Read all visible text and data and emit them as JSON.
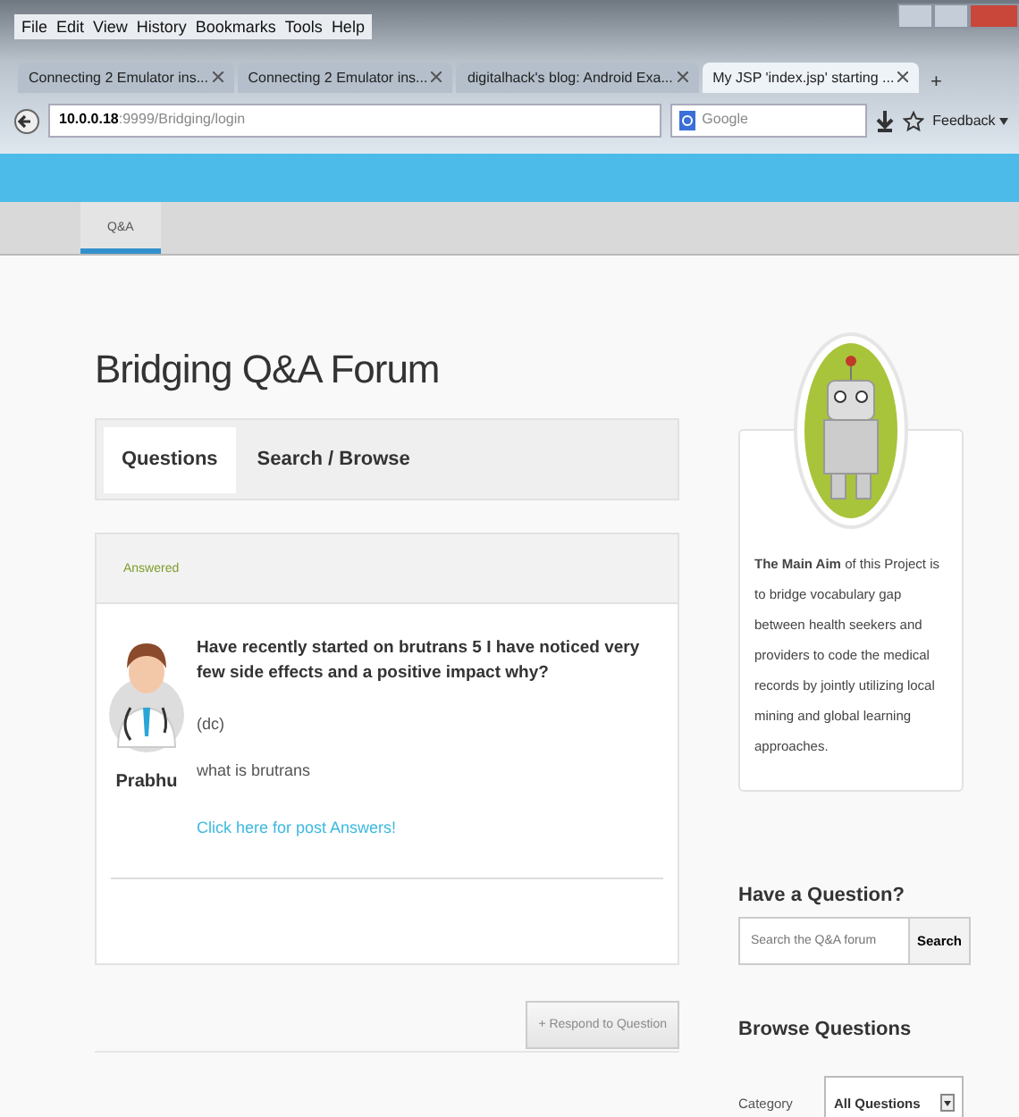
{
  "browser": {
    "menu": [
      "File",
      "Edit",
      "View",
      "History",
      "Bookmarks",
      "Tools",
      "Help"
    ],
    "tabs": [
      {
        "title": "Connecting 2 Emulator ins...",
        "selected": false
      },
      {
        "title": "Connecting 2 Emulator ins...",
        "selected": false
      },
      {
        "title": "digitalhack's blog: Android Exa...",
        "selected": false
      },
      {
        "title": "My JSP 'index.jsp' starting ...",
        "selected": true
      }
    ],
    "new_tab": "+",
    "address_host": "10.0.0.18",
    "address_rest": ":9999/Bridging/login",
    "search_placeholder": "Google",
    "feedback": "Feedback"
  },
  "site_nav": [
    {
      "label": "Q&A",
      "selected": true
    }
  ],
  "page_title": "Bridging Q&A Forum",
  "tabs": [
    {
      "label": "Questions",
      "selected": true
    },
    {
      "label": "Search / Browse",
      "selected": false
    }
  ],
  "question": {
    "status": "Answered",
    "author": "Prabhu",
    "title": "Have recently started on brutrans 5 I have noticed very few side effects and a positive impact why?",
    "tag": "(dc)",
    "body": "what is brutrans",
    "link": "Click here for post Answers!"
  },
  "respond_button": {
    "label": "+ Respond to Question",
    "disabled": true
  },
  "sidebar": {
    "about": "**The Main Aim** of this Project is to bridge vocabulary gap between health seekers and providers to code the medical records by jointly utilizing local mining and global learning approaches.",
    "question_heading": "Have a Question?",
    "search_placeholder": "Search the Q&A forum",
    "search_button": "Search",
    "browse_heading": "Browse Questions",
    "category_label": "Category",
    "category_value": "All Questions"
  }
}
